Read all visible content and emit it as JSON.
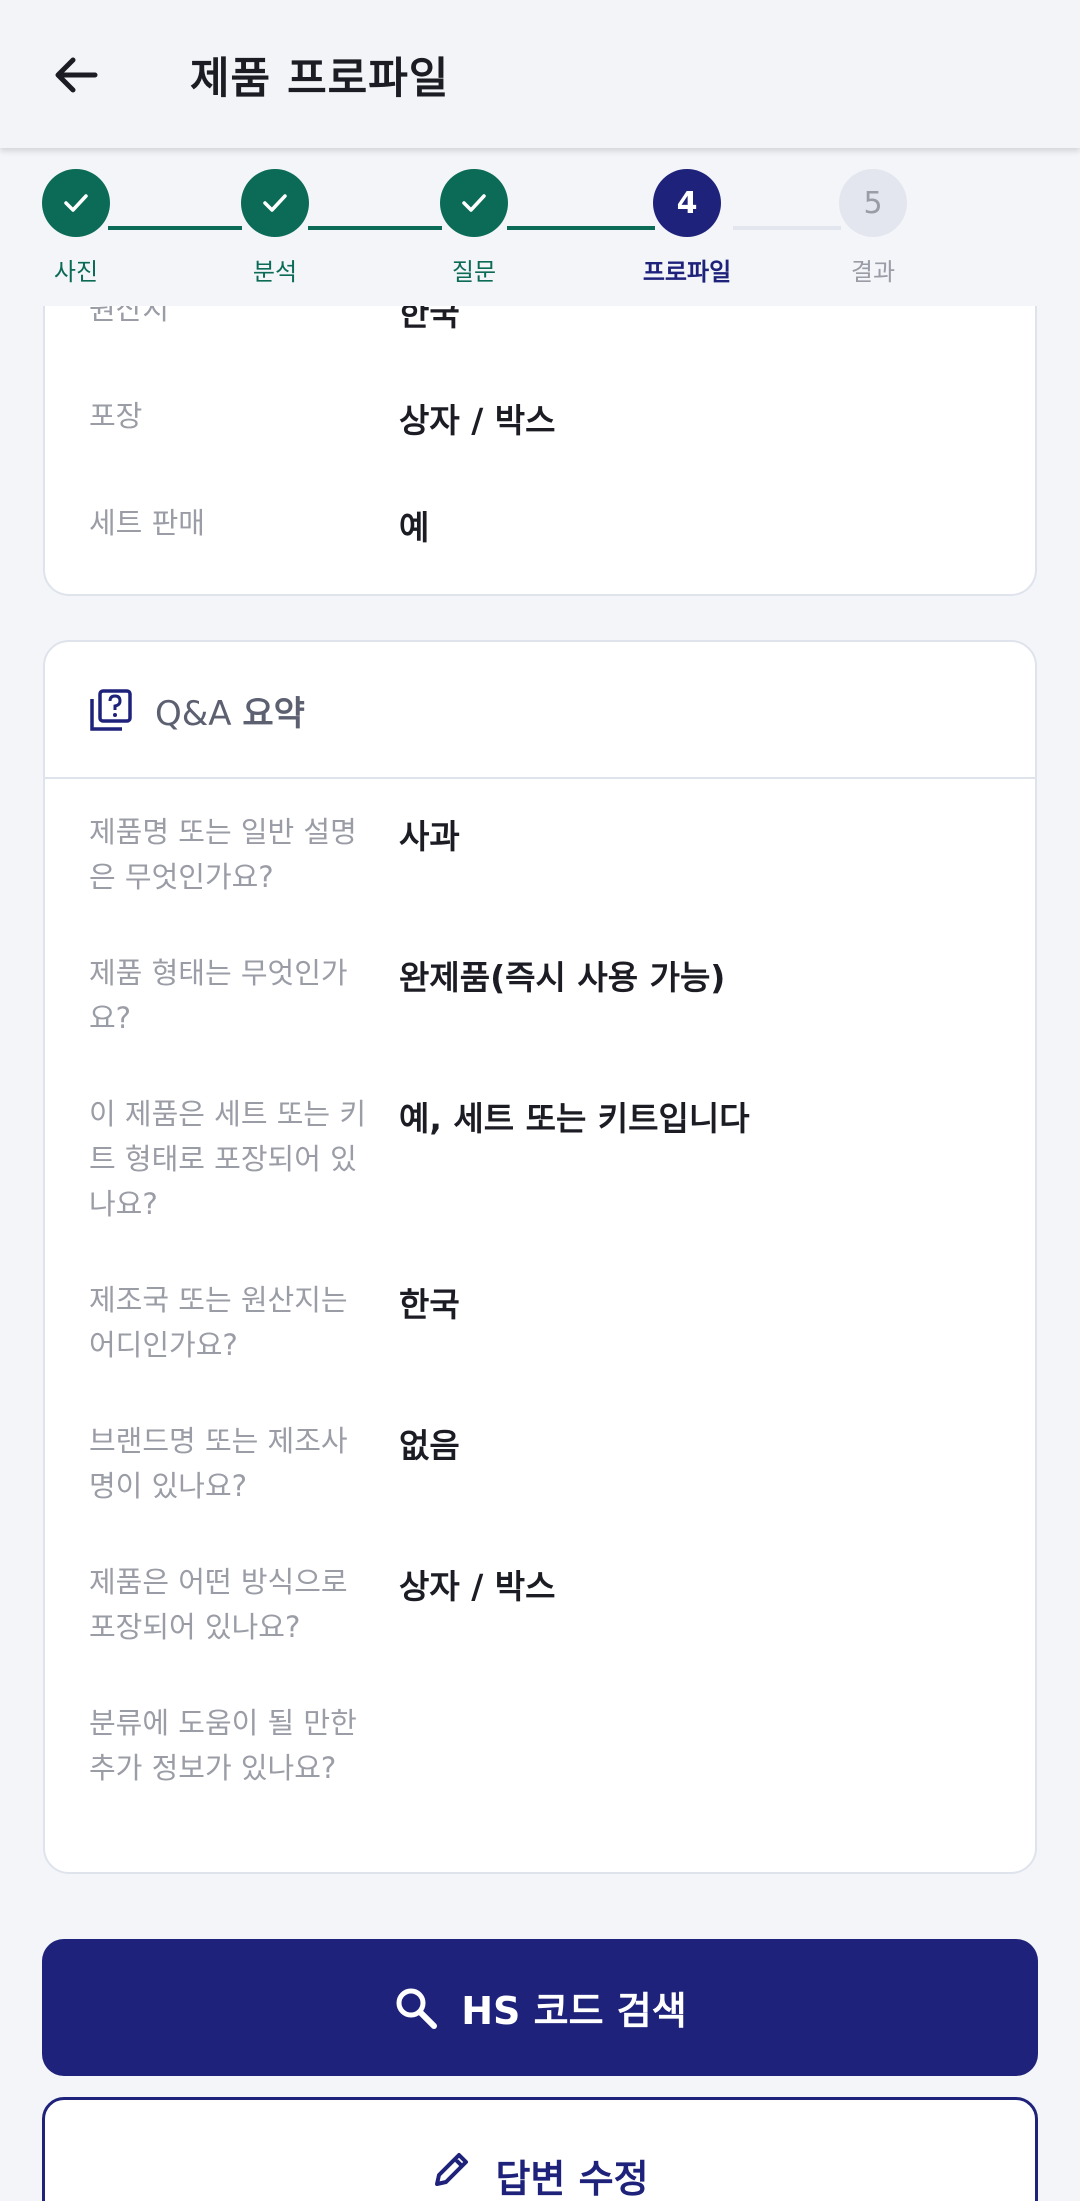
{
  "header": {
    "title": "제품 프로파일"
  },
  "stepper": {
    "steps": [
      {
        "label": "사진",
        "state": "done",
        "number": ""
      },
      {
        "label": "분석",
        "state": "done",
        "number": ""
      },
      {
        "label": "질문",
        "state": "done",
        "number": ""
      },
      {
        "label": "프로파일",
        "state": "current",
        "number": "4"
      },
      {
        "label": "결과",
        "state": "pending",
        "number": "5"
      }
    ]
  },
  "profile_card": {
    "rows": [
      {
        "label": "원산지",
        "value": "한국"
      },
      {
        "label": "포장",
        "value": "상자 / 박스"
      },
      {
        "label": "세트 판매",
        "value": "예"
      }
    ]
  },
  "qa_card": {
    "title_prefix": "Q&A",
    "title": "요약",
    "icon": "quiz-icon",
    "rows": [
      {
        "question": "제품명 또는 일반 설명은 무엇인가요?",
        "answer": "사과"
      },
      {
        "question": "제품 형태는 무엇인가요?",
        "answer": "완제품(즉시 사용 가능)"
      },
      {
        "question": "이 제품은 세트 또는 키트 형태로 포장되어 있나요?",
        "answer": "예, 세트 또는 키트입니다"
      },
      {
        "question": "제조국 또는 원산지는 어디인가요?",
        "answer": "한국"
      },
      {
        "question": "브랜드명 또는 제조사명이 있나요?",
        "answer": "없음"
      },
      {
        "question": "제품은 어떤 방식으로 포장되어 있나요?",
        "answer": "상자 / 박스"
      },
      {
        "question": "분류에 도움이 될 만한 추가 정보가 있나요?",
        "answer": ""
      }
    ]
  },
  "actions": {
    "search_label": "HS 코드 검색",
    "edit_label": "답변 수정"
  },
  "colors": {
    "primary": "#1e227a",
    "done": "#0b6b57",
    "pending": "#e3e6ee"
  }
}
